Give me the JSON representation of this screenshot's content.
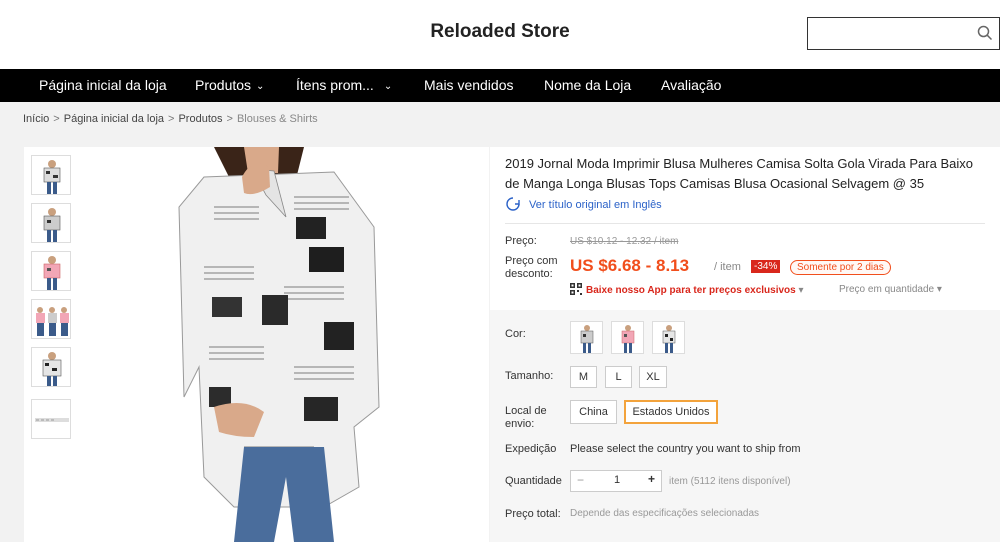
{
  "header": {
    "store_name": "Reloaded Store",
    "search_placeholder": ""
  },
  "nav": {
    "items": [
      {
        "label": "Página inicial da loja",
        "dropdown": false
      },
      {
        "label": "Produtos",
        "dropdown": true
      },
      {
        "label": "Ítens prom...",
        "dropdown": true
      },
      {
        "label": "Mais vendidos",
        "dropdown": false
      },
      {
        "label": "Nome da Loja",
        "dropdown": false
      },
      {
        "label": "Avaliação",
        "dropdown": false
      }
    ],
    "chevron": "⌄"
  },
  "breadcrumb": {
    "items": [
      "Início",
      "Página inicial da loja",
      "Produtos",
      "Blouses & Shirts"
    ],
    "separator": ">"
  },
  "product": {
    "title": "2019 Jornal Moda Imprimir Blusa Mulheres Camisa Solta Gola Virada Para Baixo de Manga Longa Blusas Tops Camisas Blusa Ocasional Selvagem @ 35",
    "original_title_link": "Ver título original em Inglês",
    "price_label": "Preço:",
    "original_price": "US $10.12 - 12.32 / item",
    "discount_label": "Preço com desconto:",
    "discount_price": "US $6.68 - 8.13",
    "per_unit": "/ item",
    "discount_badge": "-34%",
    "days_badge": "Somente por 2 dias",
    "app_promo": "Baixe nosso App para ter preços exclusivos",
    "app_promo_arrow": "▾",
    "quantity_price": "Preço em quantidade",
    "quantity_price_arrow": "▾",
    "colors": {
      "accent": "#f14e1c",
      "badge": "#d9271c",
      "link": "#2b62c8",
      "selected_border": "#f3a33c"
    }
  },
  "options": {
    "color_label": "Cor:",
    "size_label": "Tamanho:",
    "sizes": [
      "M",
      "L",
      "XL"
    ],
    "ship_label": "Local de envio:",
    "ship_from": [
      "China",
      "Estados Unidos"
    ],
    "ship_selected": "Estados Unidos",
    "shipping_label": "Expedição",
    "shipping_text": "Please select the country you want to ship from",
    "quantity_label": "Quantidade",
    "quantity_minus": "−",
    "quantity_value": "1",
    "quantity_plus": "+",
    "availability": "item (5112 itens disponível)",
    "total_label": "Preço total:",
    "total_note": "Depende das especificações selecionadas"
  },
  "icons": {
    "search": "search-icon",
    "translate": "translate-icon",
    "qr": "qr-code-icon"
  }
}
